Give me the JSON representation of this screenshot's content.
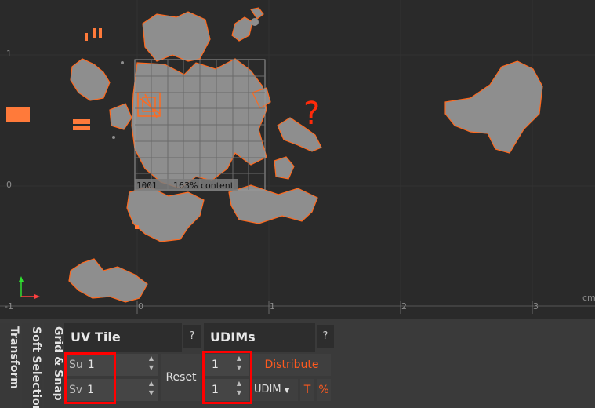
{
  "viewport": {
    "uv_tile_id": "1001",
    "content_pct": "163% content",
    "unit": "cm",
    "axis_left_labels": [
      "1",
      "0",
      "-1"
    ],
    "axis_bottom_labels": [
      "0",
      "1",
      "2",
      "3"
    ],
    "annotation": "?",
    "colors": {
      "shell_fill": "#8e8e8e",
      "border_edge": "#ff6a1f",
      "annotation": "#ff2a0a",
      "grid": "#5e5e5e"
    }
  },
  "tabs": {
    "transform": "Transform",
    "soft_selection": "Soft Selection",
    "grid_snap": "Grid & Snap"
  },
  "uv_tile": {
    "title": "UV Tile",
    "help": "?",
    "su_prefix": "Su",
    "su_value": "1",
    "sv_prefix": "Sv",
    "sv_value": "1",
    "reset_label": "Reset"
  },
  "udims": {
    "title": "UDIMs",
    "help": "?",
    "u_value": "1",
    "v_value": "1",
    "distribute_label": "Distribute",
    "mode_value": "UDIM",
    "t_label": "T",
    "percent_label": "%",
    "accent": "#ff5a1f"
  }
}
